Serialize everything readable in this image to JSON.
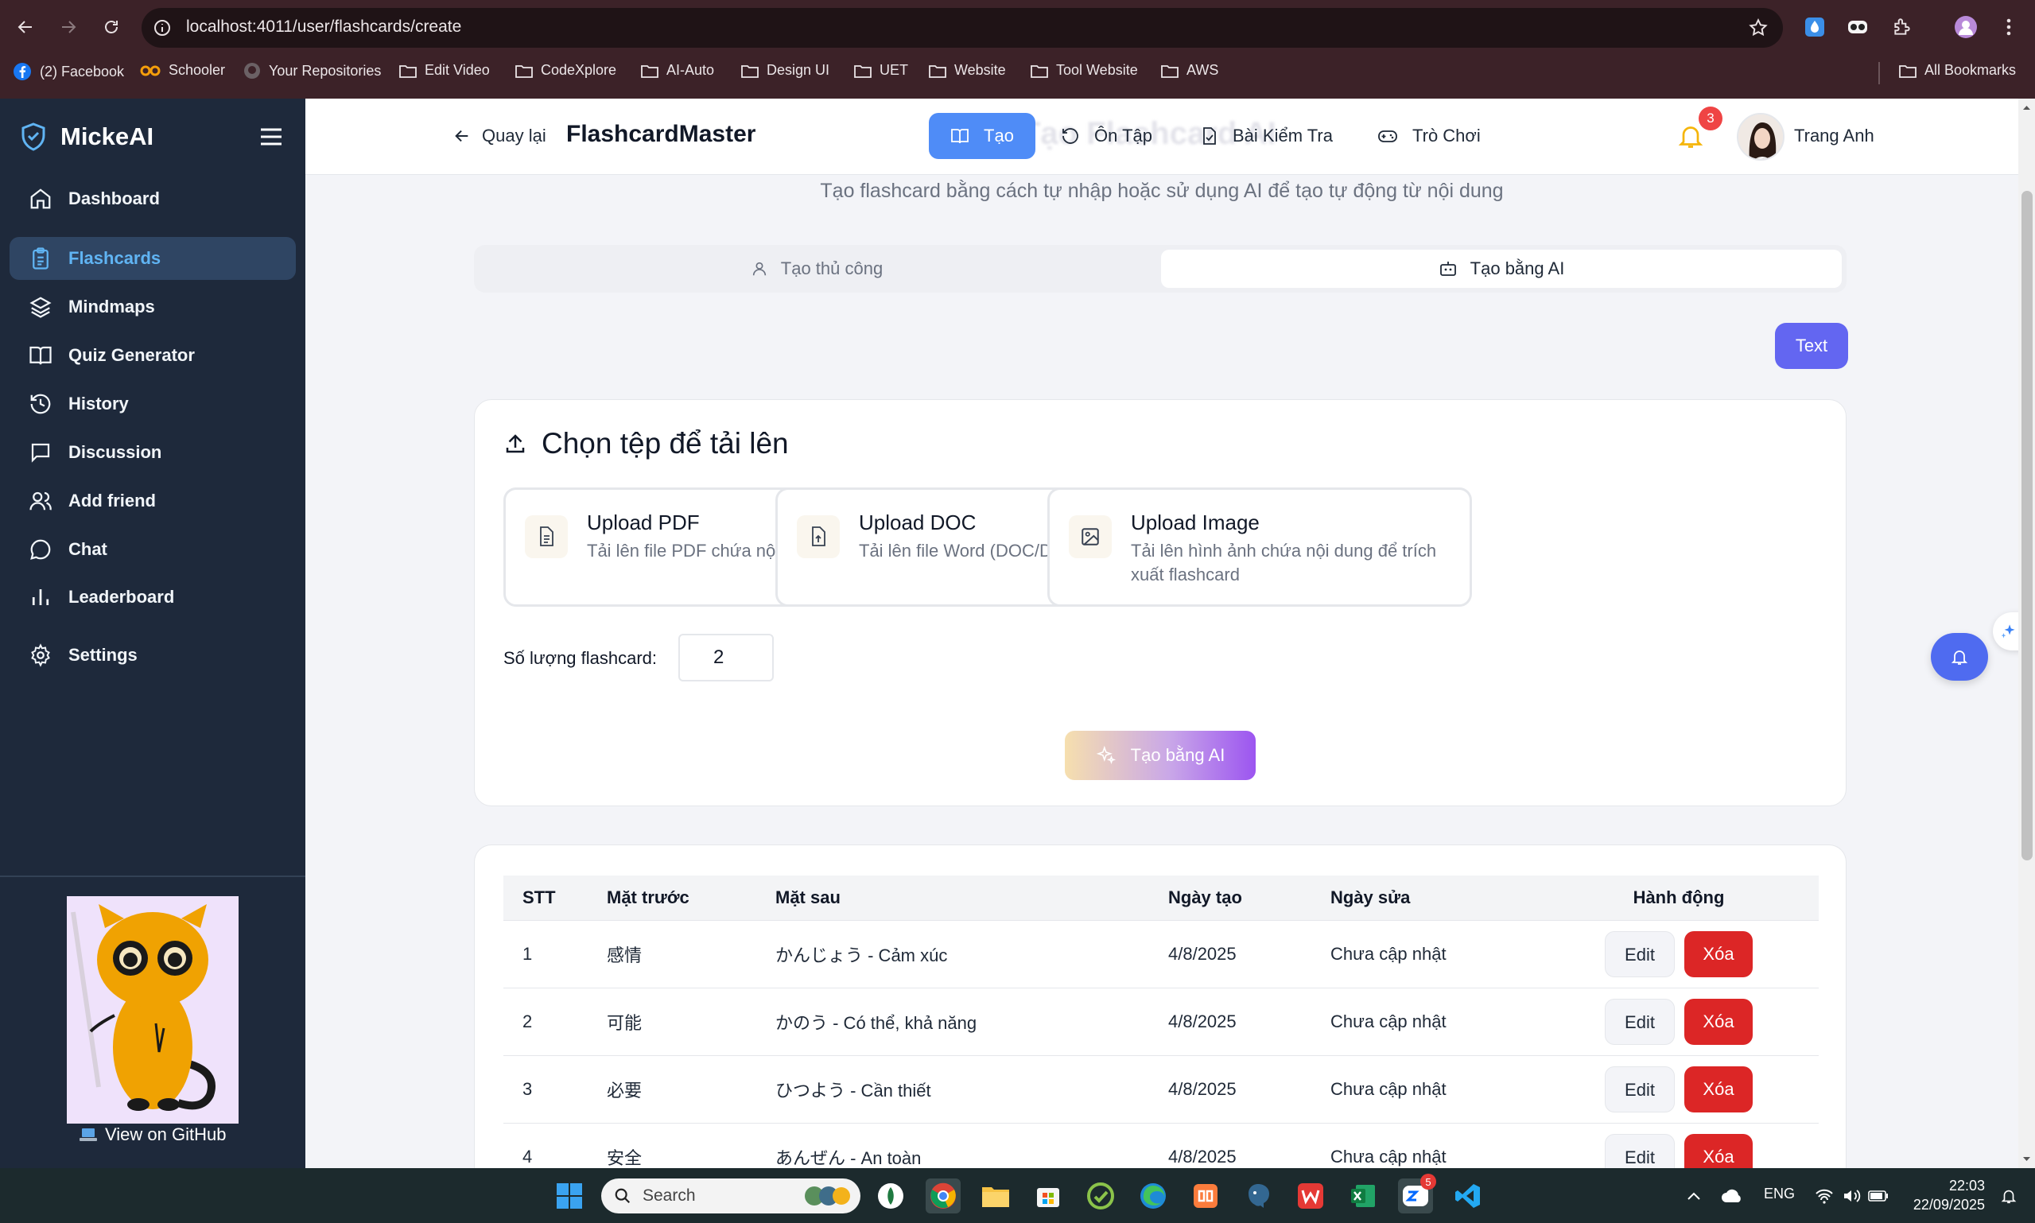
{
  "browser": {
    "url": "localhost:4011/user/flashcards/create",
    "bookmarks": [
      "(2) Facebook",
      "Schooler",
      "Your Repositories",
      "Edit Video",
      "CodeXplore",
      "AI-Auto",
      "Design UI",
      "UET",
      "Website",
      "Tool Website",
      "AWS"
    ],
    "all_bookmarks": "All Bookmarks"
  },
  "sidebar": {
    "brand": "MickeAI",
    "items": [
      {
        "label": "Dashboard",
        "icon": "home-icon"
      },
      {
        "label": "Flashcards",
        "icon": "clipboard-icon",
        "active": true
      },
      {
        "label": "Mindmaps",
        "icon": "layers-icon"
      },
      {
        "label": "Quiz Generator",
        "icon": "book-icon"
      },
      {
        "label": "History",
        "icon": "history-icon"
      },
      {
        "label": "Discussion",
        "icon": "message-square-icon"
      },
      {
        "label": "Add friend",
        "icon": "users-icon"
      },
      {
        "label": "Chat",
        "icon": "chat-bubble-icon"
      },
      {
        "label": "Leaderboard",
        "icon": "bar-chart-icon"
      },
      {
        "label": "Settings",
        "icon": "gear-icon"
      }
    ],
    "github_link": "View on GitHub"
  },
  "header": {
    "back": "Quay lại",
    "title": "FlashcardMaster",
    "ghost_title": "Tạo Flashcard AI",
    "tabs": [
      "Tạo",
      "Ôn Tập",
      "Bài Kiểm Tra",
      "Trò Chơi"
    ],
    "notification_count": "3",
    "user_name": "Trang Anh"
  },
  "main": {
    "subtitle": "Tạo flashcard bằng cách tự nhập hoặc sử dụng AI để tạo tự động từ nội dung",
    "mode_tabs": [
      "Tạo thủ công",
      "Tạo bằng AI"
    ],
    "text_button": "Text",
    "upload": {
      "title": "Chọn tệp để tải lên",
      "options": [
        {
          "title": "Upload PDF",
          "desc": "Tải lên file PDF chứa nội dung flashcard"
        },
        {
          "title": "Upload DOC",
          "desc": "Tải lên file Word (DOC/DOCX)"
        },
        {
          "title": "Upload Image",
          "desc": "Tải lên hình ảnh chứa nội dung để trích xuất flashcard"
        }
      ],
      "quantity_label": "Số lượng flashcard:",
      "quantity_value": "2",
      "generate_button": "Tạo bằng AI"
    },
    "table": {
      "headers": [
        "STT",
        "Mặt trước",
        "Mặt sau",
        "Ngày tạo",
        "Ngày sửa",
        "Hành động"
      ],
      "rows": [
        {
          "stt": "1",
          "front": "感情",
          "back": "かんじょう - Cảm xúc",
          "created": "4/8/2025",
          "updated": "Chưa cập nhật"
        },
        {
          "stt": "2",
          "front": "可能",
          "back": "かのう - Có thể, khả năng",
          "created": "4/8/2025",
          "updated": "Chưa cập nhật"
        },
        {
          "stt": "3",
          "front": "必要",
          "back": "ひつよう - Cần thiết",
          "created": "4/8/2025",
          "updated": "Chưa cập nhật"
        },
        {
          "stt": "4",
          "front": "安全",
          "back": "あんぜん - An toàn",
          "created": "4/8/2025",
          "updated": "Chưa cập nhật"
        }
      ],
      "edit_label": "Edit",
      "delete_label": "Xóa"
    }
  },
  "taskbar": {
    "search_placeholder": "Search",
    "language": "ENG",
    "time": "22:03",
    "date": "22/09/2025",
    "zalo_badge": "5"
  },
  "colors": {
    "sidebar_bg": "#1e293b",
    "active_nav": "#60b4f3",
    "primary_blue": "#4f8cf7",
    "indigo": "#6366f1",
    "danger": "#dc2626"
  }
}
